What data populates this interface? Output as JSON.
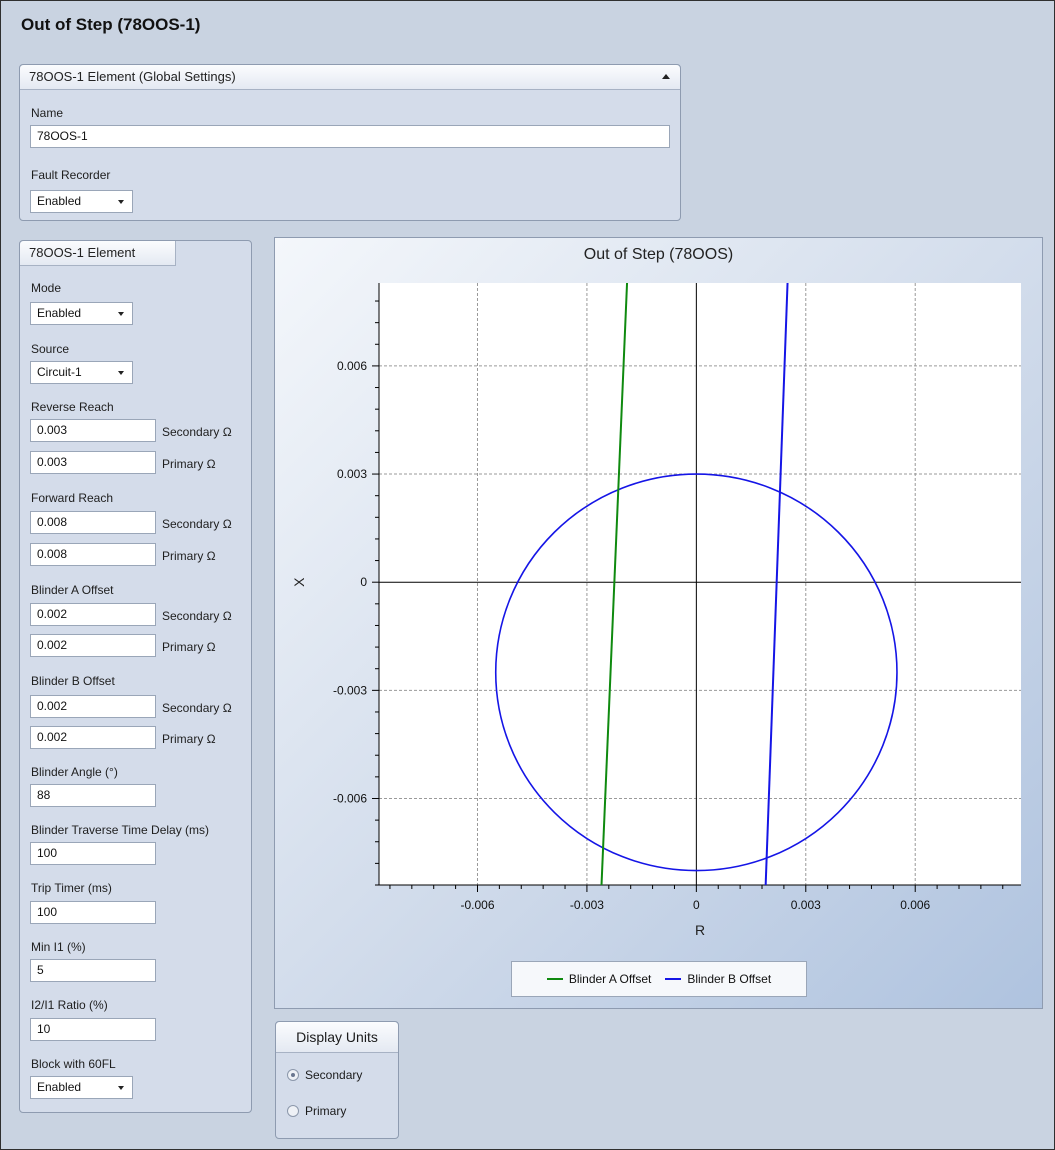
{
  "page": {
    "title": "Out of Step (78OOS-1)"
  },
  "global": {
    "header": "78OOS-1 Element (Global Settings)",
    "name_label": "Name",
    "name_value": "78OOS-1",
    "fault_recorder_label": "Fault Recorder",
    "fault_recorder_value": "Enabled"
  },
  "element": {
    "header": "78OOS-1 Element",
    "mode_label": "Mode",
    "mode_value": "Enabled",
    "source_label": "Source",
    "source_value": "Circuit-1",
    "reverse_reach_label": "Reverse Reach",
    "reverse_reach_secondary": "0.003",
    "reverse_reach_primary": "0.003",
    "forward_reach_label": "Forward Reach",
    "forward_reach_secondary": "0.008",
    "forward_reach_primary": "0.008",
    "blinder_a_label": "Blinder A Offset",
    "blinder_a_secondary": "0.002",
    "blinder_a_primary": "0.002",
    "blinder_b_label": "Blinder B Offset",
    "blinder_b_secondary": "0.002",
    "blinder_b_primary": "0.002",
    "secondary_unit": "Secondary Ω",
    "primary_unit": "Primary Ω",
    "blinder_angle_label": "Blinder Angle (°)",
    "blinder_angle_value": "88",
    "traverse_delay_label": "Blinder Traverse Time Delay (ms)",
    "traverse_delay_value": "100",
    "trip_timer_label": "Trip Timer (ms)",
    "trip_timer_value": "100",
    "min_i1_label": "Min I1 (%)",
    "min_i1_value": "5",
    "ratio_label": "I2/I1 Ratio (%)",
    "ratio_value": "10",
    "block_label": "Block with 60FL",
    "block_value": "Enabled"
  },
  "display_units": {
    "header": "Display Units",
    "secondary": "Secondary",
    "primary": "Primary",
    "selected": "Secondary"
  },
  "chart_data": {
    "type": "line",
    "title": "Out of Step (78OOS)",
    "xlabel": "R",
    "ylabel": "X",
    "xlim": [
      -0.0087,
      0.0089
    ],
    "ylim": [
      -0.0084,
      0.0083
    ],
    "xticks": [
      -0.006,
      -0.003,
      0,
      0.003,
      0.006
    ],
    "xtick_labels": [
      "-0.006",
      "-0.003",
      "0",
      "0.003",
      "0.006"
    ],
    "yticks": [
      -0.006,
      -0.003,
      0,
      0.003,
      0.006
    ],
    "ytick_labels": [
      "-0.006",
      "-0.003",
      "0",
      "0.003",
      "0.006"
    ],
    "grid": true,
    "legend_position": "bottom",
    "circle": {
      "center_r": 0.0,
      "center_x": -0.0025,
      "radius": 0.0055,
      "color": "#1515e6"
    },
    "series": [
      {
        "name": "Blinder A Offset",
        "color": "#0f8a0f",
        "x": [
          -0.0026,
          -0.0019
        ],
        "y": [
          -0.0084,
          0.0083
        ]
      },
      {
        "name": "Blinder B Offset",
        "color": "#1515e6",
        "x": [
          0.0019,
          0.0025
        ],
        "y": [
          -0.0084,
          0.0083
        ]
      }
    ]
  }
}
